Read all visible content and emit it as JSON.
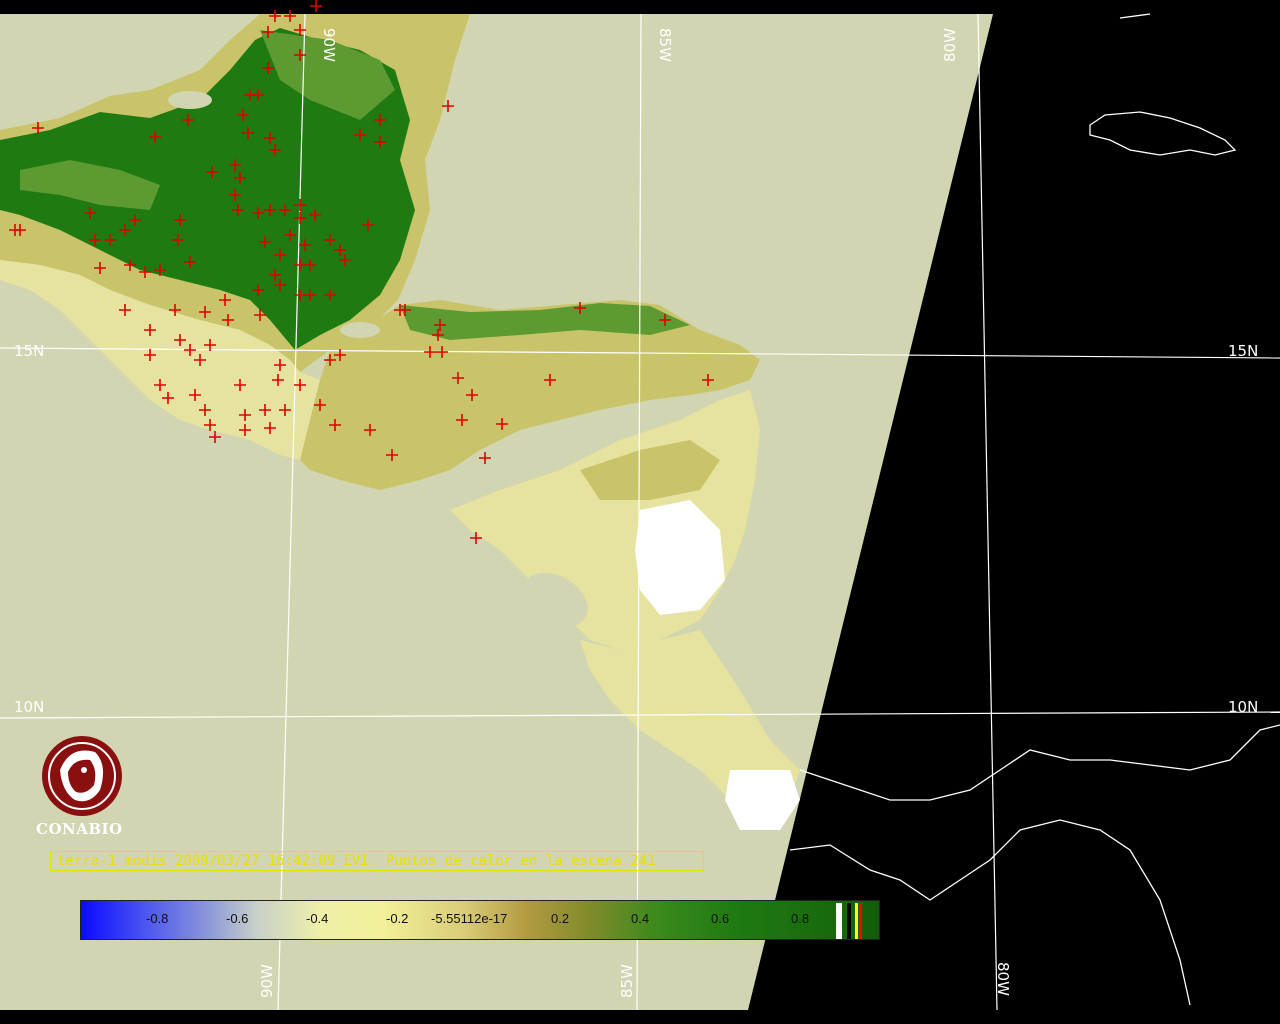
{
  "map": {
    "land_colors": {
      "background_swath": "#d2d5b1",
      "vegetation_dark": "#1f7a12",
      "vegetation_mid": "#5d9a32",
      "vegetation_light": "#c9c46a",
      "sparse": "#e6e2a0",
      "cloud": "#ffffff",
      "night": "#000000",
      "fire_marker": "#e00000",
      "coastline": "#ffffff"
    },
    "grid_labels": {
      "lon_90_top": "90W",
      "lon_85_top": "85W",
      "lon_80_top": "80W",
      "lat_15_left": "15N",
      "lat_15_right": "15N",
      "lat_10_left": "10N",
      "lat_10_right": "10N",
      "lon_90_bottom": "90W",
      "lon_85_bottom": "85W",
      "lon_80_bottom": "80W"
    },
    "fire_marker_icon": "plus-icon"
  },
  "logo": {
    "icon": "conabio-macaw-logo-icon",
    "name": "CONABIO",
    "color": "#8a1010"
  },
  "caption": "terra-1 modis 2009/03/27 16:42:09 EVI. Puntos de calor en la escena 241",
  "colorbar": {
    "ticks": [
      "-0.8",
      "-0.6",
      "-0.4",
      "-0.2",
      "-5.55112e-17",
      "0.2",
      "0.4",
      "0.6",
      "0.8"
    ],
    "end_swatches": [
      "#ffffff",
      "#000000",
      "#ffff00",
      "#ff0000"
    ]
  }
}
